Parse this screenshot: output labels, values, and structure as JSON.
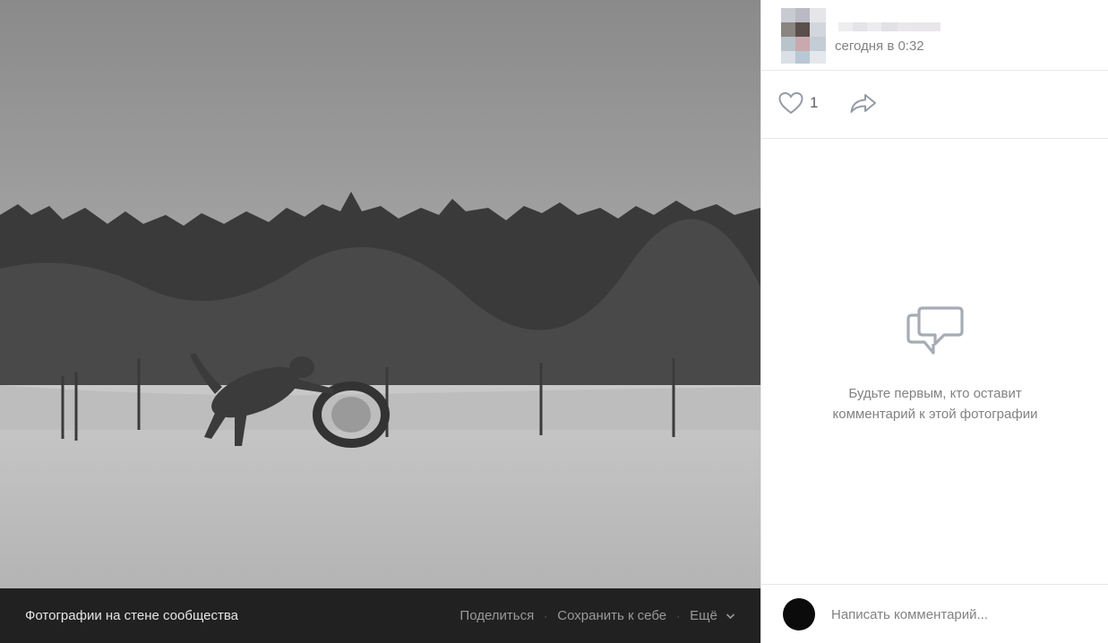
{
  "photo": {
    "description_icon": "photo",
    "album_link": "Фотографии на стене сообщества",
    "actions": {
      "share": "Поделиться",
      "save": "Сохранить к себе",
      "more": "Ещё"
    }
  },
  "post": {
    "time": "сегодня в 0:32",
    "likes": "1"
  },
  "comments": {
    "empty_line1": "Будьте первым, кто оставит",
    "empty_line2": "комментарий к этой фотографии",
    "placeholder": "Написать комментарий..."
  },
  "icons": {
    "like": "heart-icon",
    "share": "share-arrow-icon",
    "empty": "comments-bubbles-icon",
    "more": "chevron-down-icon"
  },
  "colors": {
    "bar_background": "#212121",
    "muted_text": "#828282",
    "icon_gray": "#939ba5"
  }
}
